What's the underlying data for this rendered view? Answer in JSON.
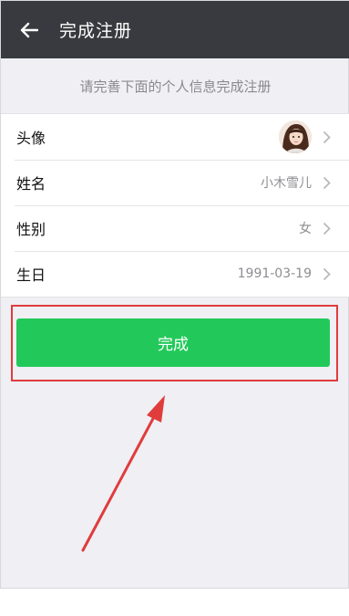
{
  "header": {
    "title": "完成注册",
    "back_icon": "arrow-left-icon"
  },
  "hint": "请完善下面的个人信息完成注册",
  "profile": {
    "avatar_label": "头像",
    "name_label": "姓名",
    "name_value": "小木雪儿",
    "gender_label": "性别",
    "gender_value": "女",
    "birthday_label": "生日",
    "birthday_value": "1991-03-19"
  },
  "done_button": "完成",
  "colors": {
    "topbar": "#393a3f",
    "button": "#22c95a",
    "annotation": "#e03c3c",
    "background": "#efeff4"
  }
}
